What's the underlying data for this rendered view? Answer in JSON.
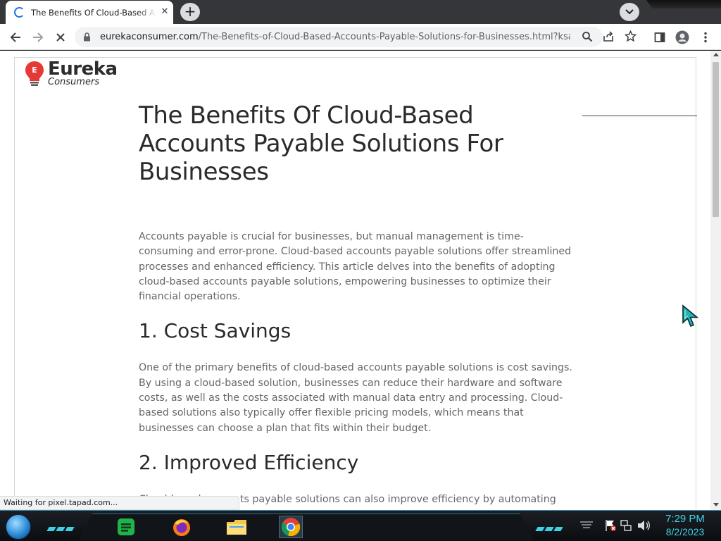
{
  "browser": {
    "tab_title": "The Benefits Of Cloud-Based Accounts Payable Solutions For Businesses",
    "tab_close_glyph": "✕",
    "new_tab_glyph": "+",
    "url_host": "eurekaconsumer.com",
    "url_path": "/The-Benefits-of-Cloud-Based-Accounts-Payable-Solutions-for-Businesses.html?ksagi...",
    "status_text": "Waiting for pixel.tapad.com..."
  },
  "site": {
    "logo_word": "Eureka",
    "logo_sub": "Consumers",
    "logo_bulb_letter": "E"
  },
  "article": {
    "title": "The Benefits Of Cloud-Based Accounts Payable Solutions For Businesses",
    "intro": "Accounts payable is crucial for businesses, but manual management is time-consuming and error-prone. Cloud-based accounts payable solutions offer streamlined processes and enhanced efficiency. This article delves into the benefits of adopting cloud-based accounts payable solutions, empowering businesses to optimize their financial operations.",
    "sections": [
      {
        "heading": "1. Cost Savings",
        "body": "One of the primary benefits of cloud-based accounts payable solutions is cost savings. By using a cloud-based solution, businesses can reduce their hardware and software costs, as well as the costs associated with manual data entry and processing. Cloud-based solutions also typically offer flexible pricing models, which means that businesses can choose a plan that fits within their budget."
      },
      {
        "heading": "2. Improved Efficiency",
        "body": "Cloud-based accounts payable solutions can also improve efficiency by automating"
      }
    ]
  },
  "taskbar": {
    "time": "7:29 PM",
    "date": "8/2/2023"
  },
  "colors": {
    "accent": "#1a73e8",
    "taskbar_accent": "#3fd0e6",
    "bulb_red": "#e53935"
  }
}
